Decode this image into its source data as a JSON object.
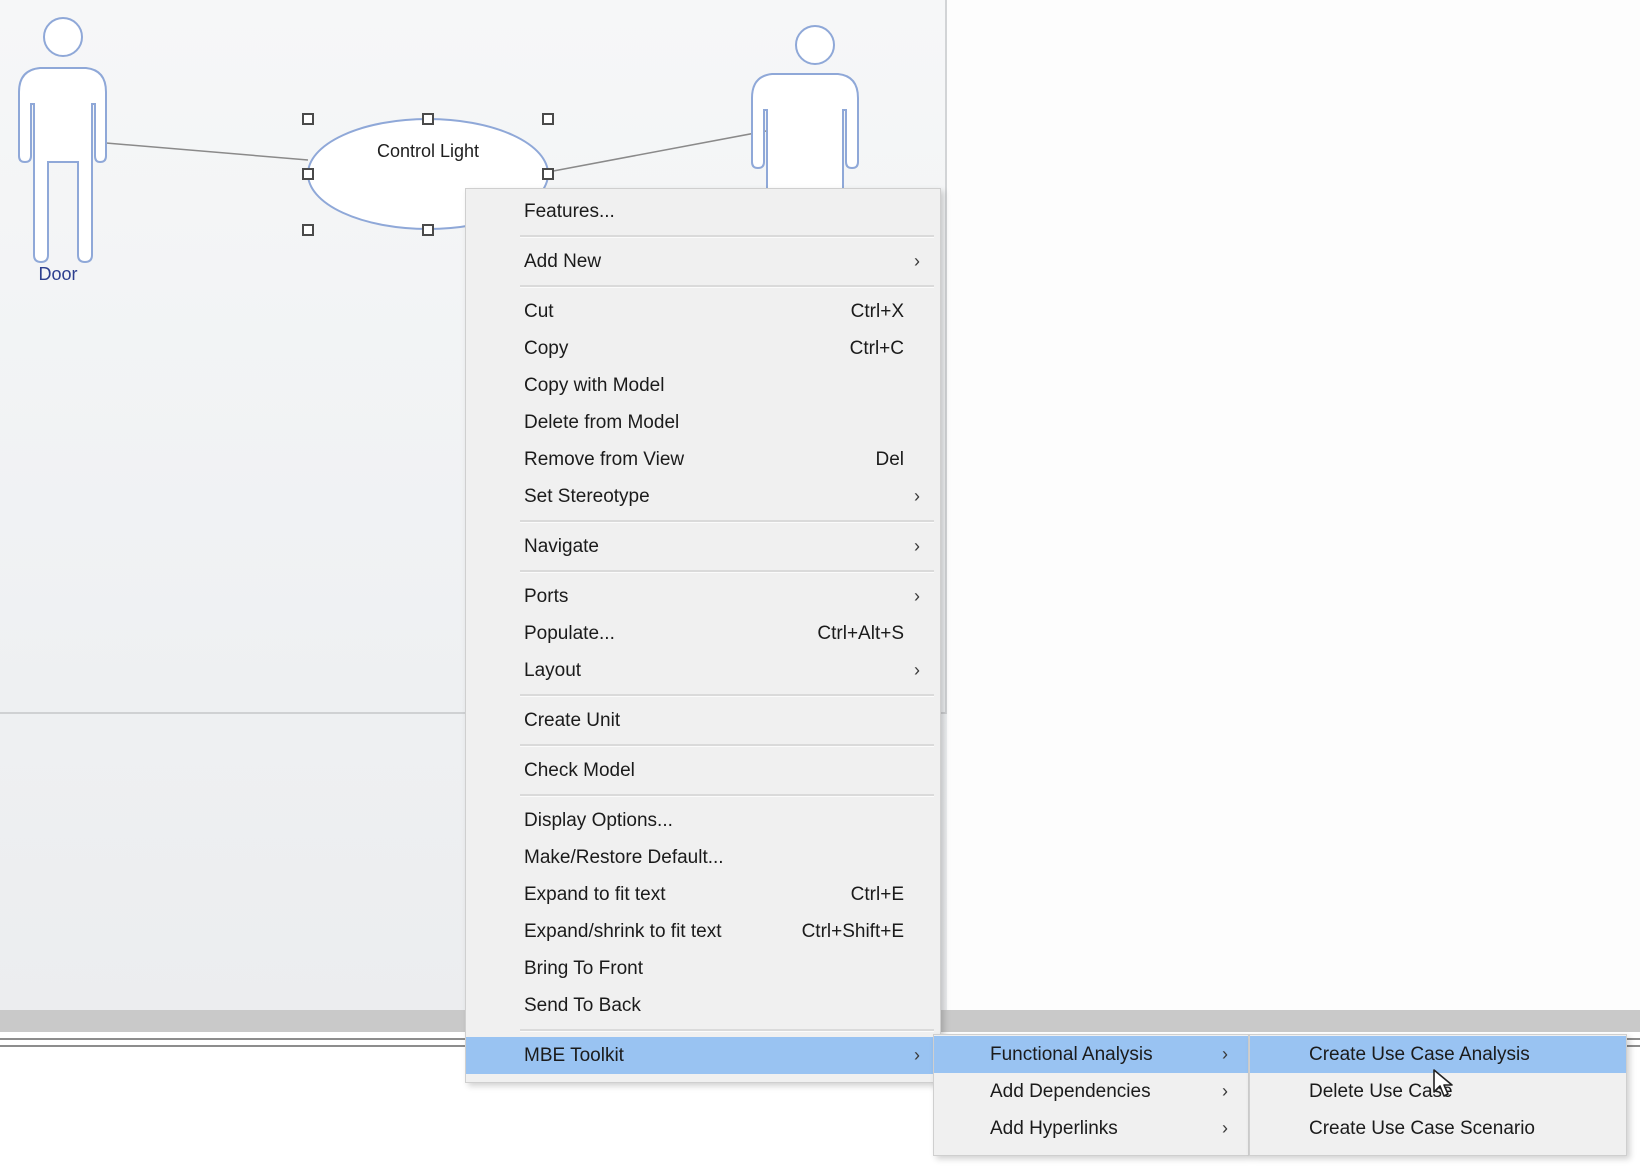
{
  "diagram": {
    "actors": [
      {
        "label": "Door"
      },
      {
        "label": ""
      }
    ],
    "use_case": {
      "label": "Control Light"
    }
  },
  "context_menu": {
    "items": [
      {
        "label": "Features...",
        "shortcut": "",
        "submenu": false
      },
      {
        "label": "Add New",
        "shortcut": "",
        "submenu": true
      },
      {
        "label": "Cut",
        "shortcut": "Ctrl+X",
        "submenu": false
      },
      {
        "label": "Copy",
        "shortcut": "Ctrl+C",
        "submenu": false
      },
      {
        "label": "Copy with Model",
        "shortcut": "",
        "submenu": false
      },
      {
        "label": "Delete from Model",
        "shortcut": "",
        "submenu": false
      },
      {
        "label": "Remove from View",
        "shortcut": "Del",
        "submenu": false
      },
      {
        "label": "Set Stereotype",
        "shortcut": "",
        "submenu": true
      },
      {
        "label": "Navigate",
        "shortcut": "",
        "submenu": true
      },
      {
        "label": "Ports",
        "shortcut": "",
        "submenu": true
      },
      {
        "label": "Populate...",
        "shortcut": "Ctrl+Alt+S",
        "submenu": false
      },
      {
        "label": "Layout",
        "shortcut": "",
        "submenu": true
      },
      {
        "label": "Create Unit",
        "shortcut": "",
        "submenu": false
      },
      {
        "label": "Check Model",
        "shortcut": "",
        "submenu": false
      },
      {
        "label": "Display Options...",
        "shortcut": "",
        "submenu": false
      },
      {
        "label": "Make/Restore Default...",
        "shortcut": "",
        "submenu": false
      },
      {
        "label": "Expand to fit text",
        "shortcut": "Ctrl+E",
        "submenu": false
      },
      {
        "label": "Expand/shrink to fit text",
        "shortcut": "Ctrl+Shift+E",
        "submenu": false
      },
      {
        "label": "Bring To Front",
        "shortcut": "",
        "submenu": false
      },
      {
        "label": "Send To Back",
        "shortcut": "",
        "submenu": false
      },
      {
        "label": "MBE Toolkit",
        "shortcut": "",
        "submenu": true,
        "highlighted": true
      }
    ],
    "arrow_glyph": "›"
  },
  "submenu_mbe_toolkit": {
    "items": [
      {
        "label": "Functional Analysis",
        "submenu": true,
        "highlighted": true
      },
      {
        "label": "Add Dependencies",
        "submenu": true
      },
      {
        "label": "Add Hyperlinks",
        "submenu": true
      }
    ]
  },
  "submenu_functional_analysis": {
    "items": [
      {
        "label": "Create Use Case Analysis",
        "highlighted": true
      },
      {
        "label": "Delete Use Case"
      },
      {
        "label": "Create Use Case Scenario"
      }
    ]
  },
  "colors": {
    "highlight": "#99c3f2",
    "actor_stroke": "#8fa8d8",
    "actor_label": "#2d3f8f",
    "menu_bg": "#f0f0f0"
  }
}
